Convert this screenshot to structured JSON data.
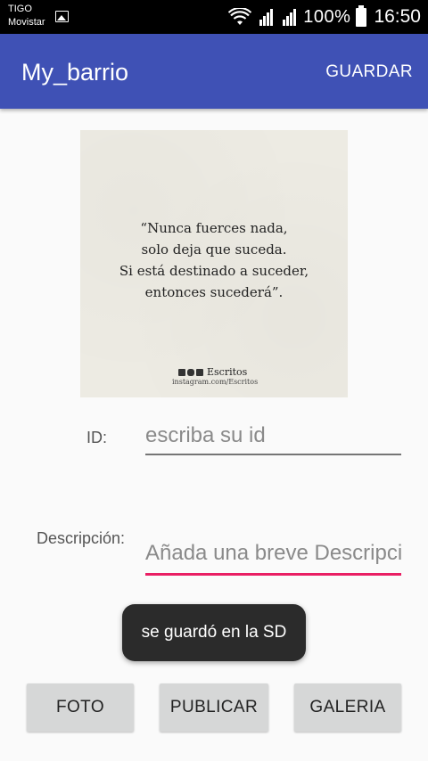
{
  "status_bar": {
    "carrier_1": "TIGO",
    "carrier_2": "Movistar",
    "battery": "100%",
    "time": "16:50",
    "icons": [
      "gallery-icon",
      "wifi-icon",
      "signal-1-icon",
      "signal-2-icon",
      "battery-icon"
    ]
  },
  "app_bar": {
    "title": "My_barrio",
    "action_label": "GUARDAR",
    "color": "#3f51b5"
  },
  "image": {
    "quote_lines": [
      "“Nunca fuerces nada,",
      "solo deja que suceda.",
      "Si está destinado a suceder,",
      "entonces sucederá”."
    ],
    "brand": "Escritos",
    "url": "instagram.com/Escritos"
  },
  "form": {
    "id_label": "ID:",
    "id_placeholder": "escriba su id",
    "description_label": "Descripción:",
    "description_placeholder": "Añada una breve Descripción"
  },
  "toast": "se guardó en la SD",
  "buttons": {
    "foto": "FOTO",
    "publicar": "PUBLICAR",
    "galeria": "GALERIA"
  },
  "colors": {
    "primary": "#3f51b5",
    "accent": "#e91e63"
  }
}
